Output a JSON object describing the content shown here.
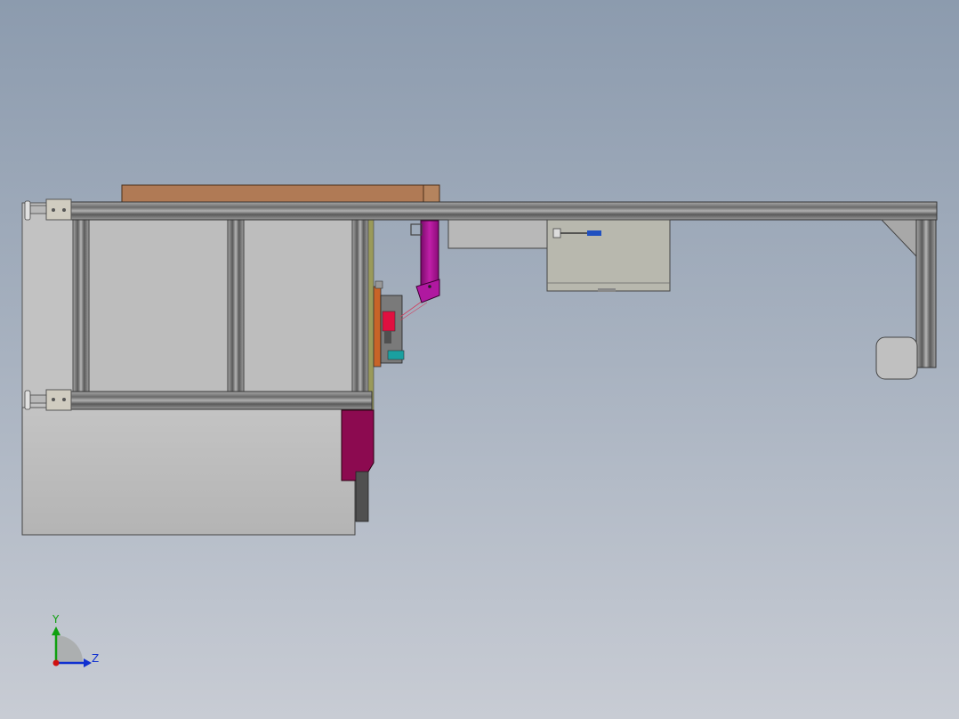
{
  "viewport": {
    "background_top": "#8c9bae",
    "background_bottom": "#c8ccd4"
  },
  "colors": {
    "profile_light": "#9a9a9a",
    "profile_dark": "#3c3c3c",
    "panel_gray": "#c0c0c0",
    "panel_beige": "#b8b8ae",
    "wood": "#b07a55",
    "magenta": "#a0108a",
    "maroon": "#8c0a50",
    "mount_tan": "#d0ccc0",
    "teal": "#1aa0a0",
    "olive": "#8a8a4a"
  },
  "triad": {
    "y_label": "Y",
    "z_label": "Z",
    "y_color": "#10a010",
    "z_color": "#1030d0",
    "x_color": "#d01010"
  }
}
